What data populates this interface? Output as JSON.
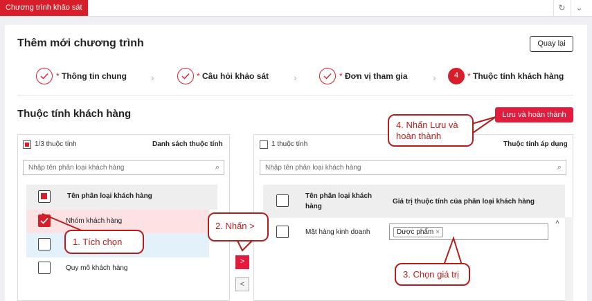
{
  "top_tab": "Chương trình khảo sát",
  "page": {
    "title": "Thêm mới chương trình",
    "back_label": "Quay lại"
  },
  "steps": [
    {
      "required": "*",
      "label": "Thông tin chung"
    },
    {
      "required": "*",
      "label": "Câu hỏi khảo sát"
    },
    {
      "required": "*",
      "label": "Đơn vị tham gia"
    },
    {
      "number": "4",
      "required": "*",
      "label": "Thuộc tính khách hàng"
    }
  ],
  "section_title": "Thuộc tính khách hàng",
  "save_label": "Lưu và hoàn thành",
  "left_panel": {
    "count": "1/3 thuộc tính",
    "title": "Danh sách thuộc tính",
    "search_placeholder": "Nhập tên phân loại khách hàng",
    "col_header": "Tên phân loại khách hàng",
    "rows": [
      {
        "label": "Nhóm khách hàng",
        "checked": true
      },
      {
        "label": "",
        "checked": false
      },
      {
        "label": "Quy mô khách hàng",
        "checked": false
      }
    ]
  },
  "move_right": ">",
  "move_left": "<",
  "right_panel": {
    "count": "1 thuộc tính",
    "title": "Thuộc tính áp dụng",
    "search_placeholder": "Nhập tên phân loại khách hàng",
    "col1_header_line1": "Tên phân loại khách",
    "col1_header_line2": "hàng",
    "col2_header": "Giá trị thuộc tính của phân loại khách hàng",
    "rows": [
      {
        "label": "Mặt hàng kinh doanh",
        "values": [
          "Dược phẩm"
        ]
      }
    ]
  },
  "callouts": {
    "c1": "1. Tích chọn",
    "c2": "2. Nhấn >",
    "c3": "3. Chọn giá trị",
    "c4_line1": "4. Nhấn Lưu và",
    "c4_line2": "hoàn thành"
  },
  "icons": {
    "refresh": "refresh-icon",
    "chevron": "chevron-down-icon",
    "search": "search-icon",
    "check": "check-icon",
    "remove": "remove-chip-icon",
    "scroll_up": "scroll-up-icon"
  },
  "colors": {
    "accent": "#d71f2b",
    "selected_row": "#fde2e4",
    "hover_row": "#e3f1fa",
    "callout": "#b71c1c"
  }
}
